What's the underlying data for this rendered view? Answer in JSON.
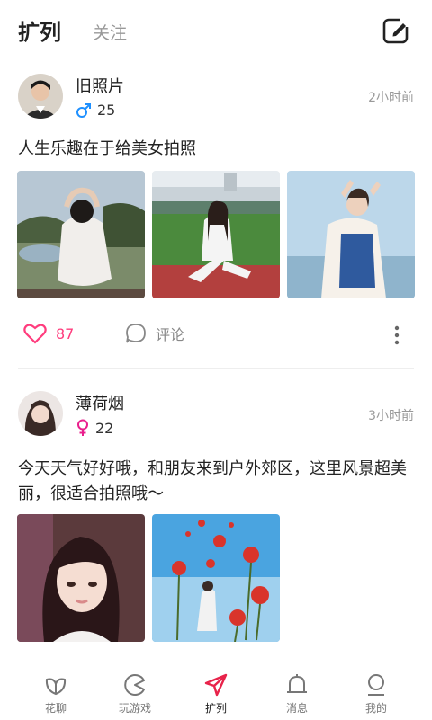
{
  "header": {
    "tab_main": "扩列",
    "tab_follow": "关注",
    "edit_icon": "edit-icon"
  },
  "posts": [
    {
      "username": "旧照片",
      "gender": "male",
      "age": "25",
      "time": "2小时前",
      "text": "人生乐趣在于给美女拍照",
      "likes": "87",
      "comment_label": "评论"
    },
    {
      "username": "薄荷烟",
      "gender": "female",
      "age": "22",
      "time": "3小时前",
      "text": "今天天气好好哦，和朋友来到户外郊区，这里风景超美丽，很适合拍照哦～"
    }
  ],
  "colors": {
    "accent": "#ff3c7d",
    "male": "#1e90ff",
    "female": "#e91e8c"
  },
  "bottom_nav": [
    {
      "label": "花聊",
      "icon": "leaf-icon"
    },
    {
      "label": "玩游戏",
      "icon": "pacman-icon"
    },
    {
      "label": "扩列",
      "icon": "paper-plane-icon"
    },
    {
      "label": "消息",
      "icon": "bell-icon"
    },
    {
      "label": "我的",
      "icon": "person-icon"
    }
  ]
}
